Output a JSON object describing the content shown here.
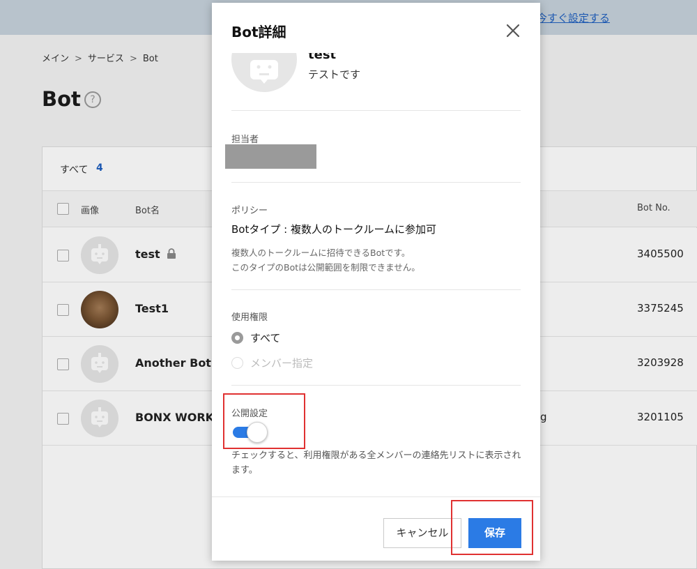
{
  "top_banner": {
    "link_text": "今すぐ設定する"
  },
  "breadcrumb": [
    "メイン",
    "サービス",
    "Bot"
  ],
  "breadcrumb_separator": ">",
  "page": {
    "title": "Bot",
    "help_glyph": "?"
  },
  "table": {
    "count_label": "すべて",
    "count_value": "4",
    "columns": {
      "image": "画像",
      "bot_name": "Bot名",
      "bot_no": "Bot No."
    },
    "rows": [
      {
        "name": "test",
        "locked": true,
        "extra": "",
        "bot_no": "3405500",
        "avatar": "bot-placeholder"
      },
      {
        "name": "Test1",
        "locked": false,
        "extra": "",
        "bot_no": "3375245",
        "avatar": "photo"
      },
      {
        "name": "Another Bot",
        "locked": false,
        "extra": "",
        "bot_no": "3203928",
        "avatar": "bot-placeholder"
      },
      {
        "name": "BONX WORK T",
        "locked": false,
        "extra": "g",
        "bot_no": "3201105",
        "avatar": "bot-placeholder"
      }
    ]
  },
  "modal": {
    "title": "Bot詳細",
    "close_icon": "close-icon",
    "bot": {
      "name": "test",
      "description": "テストです"
    },
    "owner": {
      "label": "担当者"
    },
    "policy": {
      "label": "ポリシー",
      "type_text": "Botタイプ : 複数人のトークルームに参加可",
      "note_line1": "複数人のトークルームに招待できるBotです。",
      "note_line2": "このタイプのBotは公開範囲を制限できません。"
    },
    "permission": {
      "label": "使用権限",
      "options": [
        {
          "label": "すべて",
          "selected": true,
          "disabled": false
        },
        {
          "label": "メンバー指定",
          "selected": false,
          "disabled": true
        }
      ]
    },
    "public_setting": {
      "label": "公開設定",
      "enabled": true,
      "note": "チェックすると、利用権限がある全メンバーの連絡先リストに表示されます。"
    },
    "buttons": {
      "cancel": "キャンセル",
      "save": "保存"
    }
  },
  "colors": {
    "accent": "#2b7be5",
    "highlight": "#e03131",
    "link": "#1f5fbf"
  }
}
